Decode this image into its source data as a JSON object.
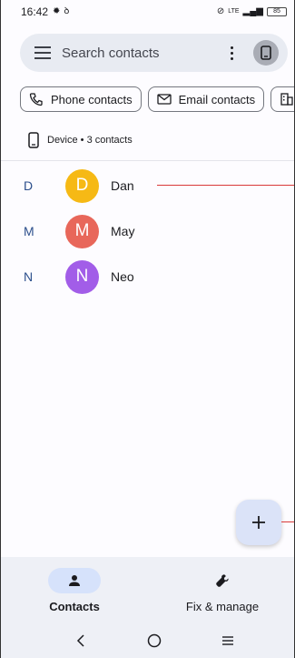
{
  "status_bar": {
    "time": "16:42",
    "battery": "85"
  },
  "search": {
    "placeholder": "Search contacts"
  },
  "chips": [
    {
      "label": "Phone contacts",
      "icon": "phone-icon"
    },
    {
      "label": "Email contacts",
      "icon": "email-icon"
    },
    {
      "label": "",
      "icon": "building-icon"
    }
  ],
  "account": {
    "source_label": "Device • 3 contacts"
  },
  "contacts": [
    {
      "letter": "D",
      "initial": "D",
      "name": "Dan",
      "color": "#f6b915"
    },
    {
      "letter": "M",
      "initial": "M",
      "name": "May",
      "color": "#e8675a"
    },
    {
      "letter": "N",
      "initial": "N",
      "name": "Neo",
      "color": "#a25de8"
    }
  ],
  "fab": {
    "icon": "plus-icon"
  },
  "bottom_nav": {
    "items": [
      {
        "label": "Contacts",
        "icon": "person-icon",
        "active": true
      },
      {
        "label": "Fix & manage",
        "icon": "wrench-icon",
        "active": false
      }
    ]
  },
  "colors": {
    "accent": "#2c4f8c",
    "surface": "#e8ebf2",
    "fab": "#dbe3f8",
    "active_pill": "#d6e2fb"
  }
}
